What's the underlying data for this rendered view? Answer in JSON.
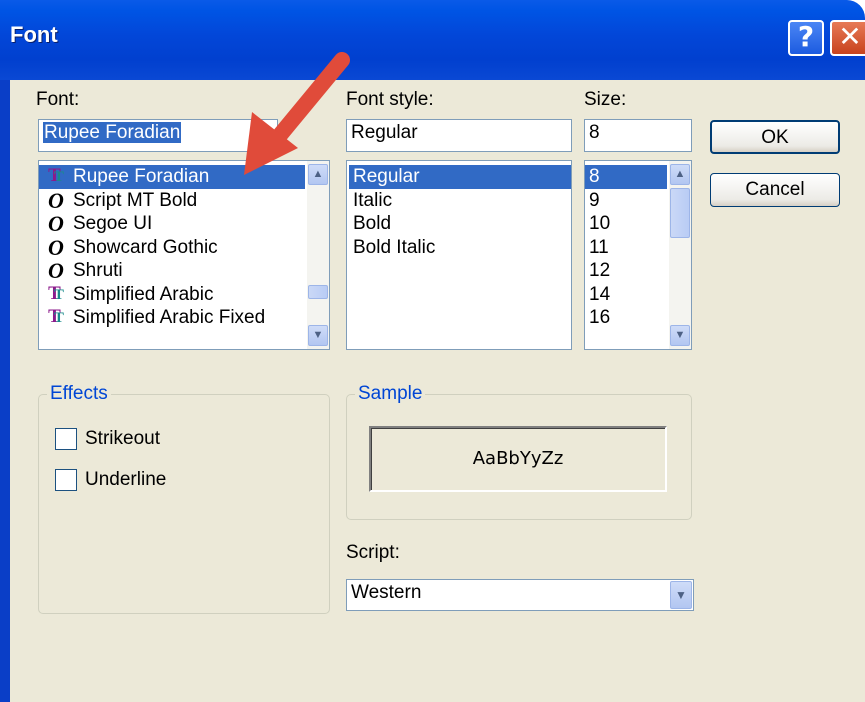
{
  "window": {
    "title": "Font",
    "help_glyph": "?",
    "close_glyph": "✕"
  },
  "font": {
    "label": "Font:",
    "value": "Rupee Foradian",
    "items": [
      {
        "name": "Rupee Foradian",
        "icon": "truetype-icon",
        "selected": true
      },
      {
        "name": "Script MT Bold",
        "icon": "opentype-icon",
        "selected": false
      },
      {
        "name": "Segoe UI",
        "icon": "opentype-icon",
        "selected": false
      },
      {
        "name": "Showcard Gothic",
        "icon": "opentype-icon",
        "selected": false
      },
      {
        "name": "Shruti",
        "icon": "opentype-icon",
        "selected": false
      },
      {
        "name": "Simplified Arabic",
        "icon": "truetype-icon",
        "selected": false
      },
      {
        "name": "Simplified Arabic Fixed",
        "icon": "truetype-icon",
        "selected": false
      }
    ]
  },
  "style": {
    "label": "Font style:",
    "value": "Regular",
    "items": [
      "Regular",
      "Italic",
      "Bold",
      "Bold Italic"
    ]
  },
  "size": {
    "label": "Size:",
    "value": "8",
    "items": [
      "8",
      "9",
      "10",
      "11",
      "12",
      "14",
      "16"
    ]
  },
  "buttons": {
    "ok": "OK",
    "cancel": "Cancel"
  },
  "effects": {
    "title": "Effects",
    "strikeout": "Strikeout",
    "underline": "Underline"
  },
  "sample": {
    "title": "Sample",
    "text": "AaBbYyZz"
  },
  "script": {
    "label": "Script:",
    "value": "Western"
  },
  "colors": {
    "selection": "#316ac5",
    "group_title": "#0046d5",
    "annotation_arrow": "#e04b3a"
  }
}
